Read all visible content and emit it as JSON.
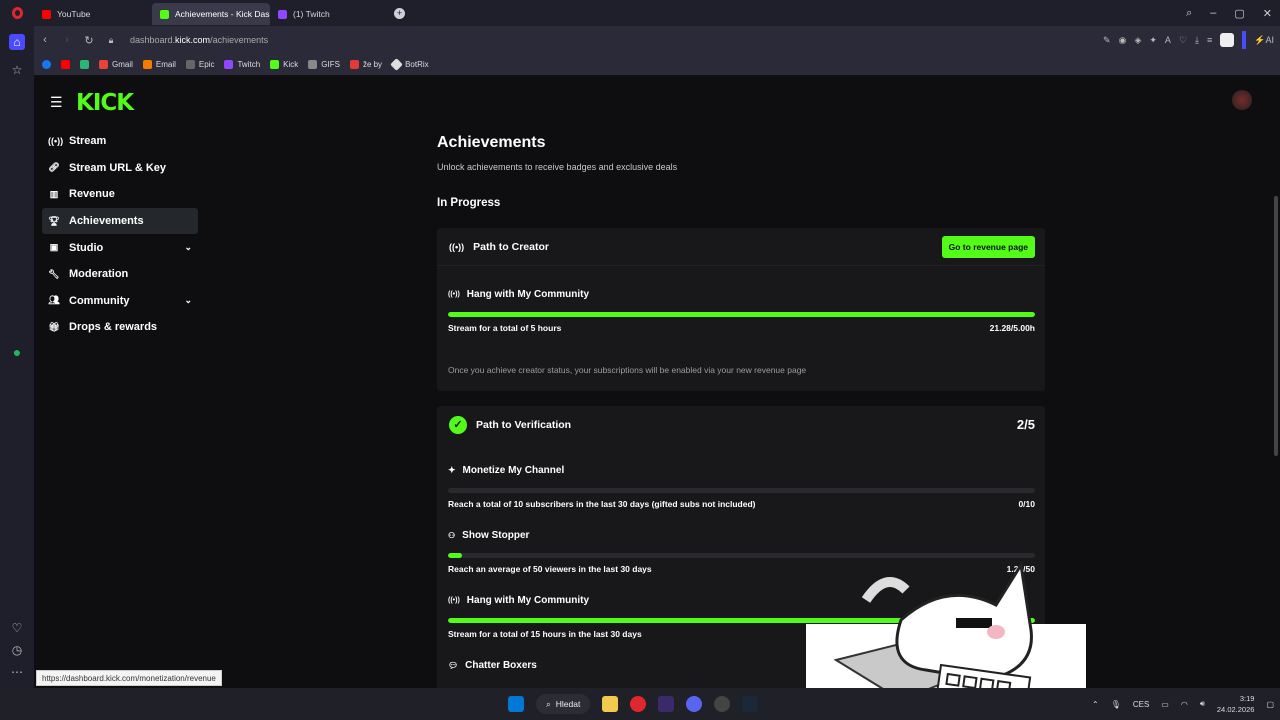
{
  "browser": {
    "tabs": [
      {
        "label": "YouTube",
        "color": "#ff0000"
      },
      {
        "label": "Achievements - Kick Dashb",
        "color": "#53fc18"
      },
      {
        "label": "(1) Twitch",
        "color": "#9146ff"
      }
    ],
    "url_prefix": "dashboard.",
    "url_domain": "kick.com",
    "url_path": "/achievements",
    "ai_label": "AI",
    "bookmarks": [
      "Gmail",
      "Email",
      "Epic",
      "Twitch",
      "Kick",
      "GIFS",
      "že by",
      "BotRix"
    ],
    "status_url": "https://dashboard.kick.com/monetization/revenue"
  },
  "site": {
    "logo": "KICK",
    "nav": [
      {
        "label": "Stream",
        "icon": "broadcast-icon"
      },
      {
        "label": "Stream URL & Key",
        "icon": "link-icon"
      },
      {
        "label": "Revenue",
        "icon": "chart-icon"
      },
      {
        "label": "Achievements",
        "icon": "trophy-icon"
      },
      {
        "label": "Studio",
        "icon": "studio-icon"
      },
      {
        "label": "Moderation",
        "icon": "wrench-icon"
      },
      {
        "label": "Community",
        "icon": "people-icon"
      },
      {
        "label": "Drops & rewards",
        "icon": "gift-icon"
      }
    ]
  },
  "main": {
    "title": "Achievements",
    "subtitle": "Unlock achievements to receive badges and exclusive deals",
    "section": "In Progress",
    "creator": {
      "title": "Path to Creator",
      "button": "Go to revenue page",
      "task_title": "Hang with My Community",
      "task_desc": "Stream for a total of 5 hours",
      "task_value": "21.28/5.00h",
      "progress": 1.0,
      "note": "Once you achieve creator status, your subscriptions will be enabled via your new revenue page"
    },
    "verification": {
      "title": "Path to Verification",
      "score": "2/5",
      "tasks": [
        {
          "title": "Monetize My Channel",
          "desc": "Reach a total of 10 subscribers in the last 30 days (gifted subs not included)",
          "value": "0/10",
          "progress": 0.0
        },
        {
          "title": "Show Stopper",
          "desc": "Reach an average of 50 viewers in the last 30 days",
          "value": "1.22/50",
          "progress": 0.024
        },
        {
          "title": "Hang with My Community",
          "desc": "Stream for a total of 15 hours in the last 30 days",
          "value": "h",
          "progress": 1.0
        },
        {
          "title": "Chatter Boxers"
        }
      ]
    }
  },
  "taskbar": {
    "search": "Hledat",
    "lang": "CES",
    "time": "3:19",
    "date": "24.02.2026"
  },
  "colors": {
    "accent": "#53fc18",
    "bg": "#0e0e10",
    "card": "#18181b"
  }
}
